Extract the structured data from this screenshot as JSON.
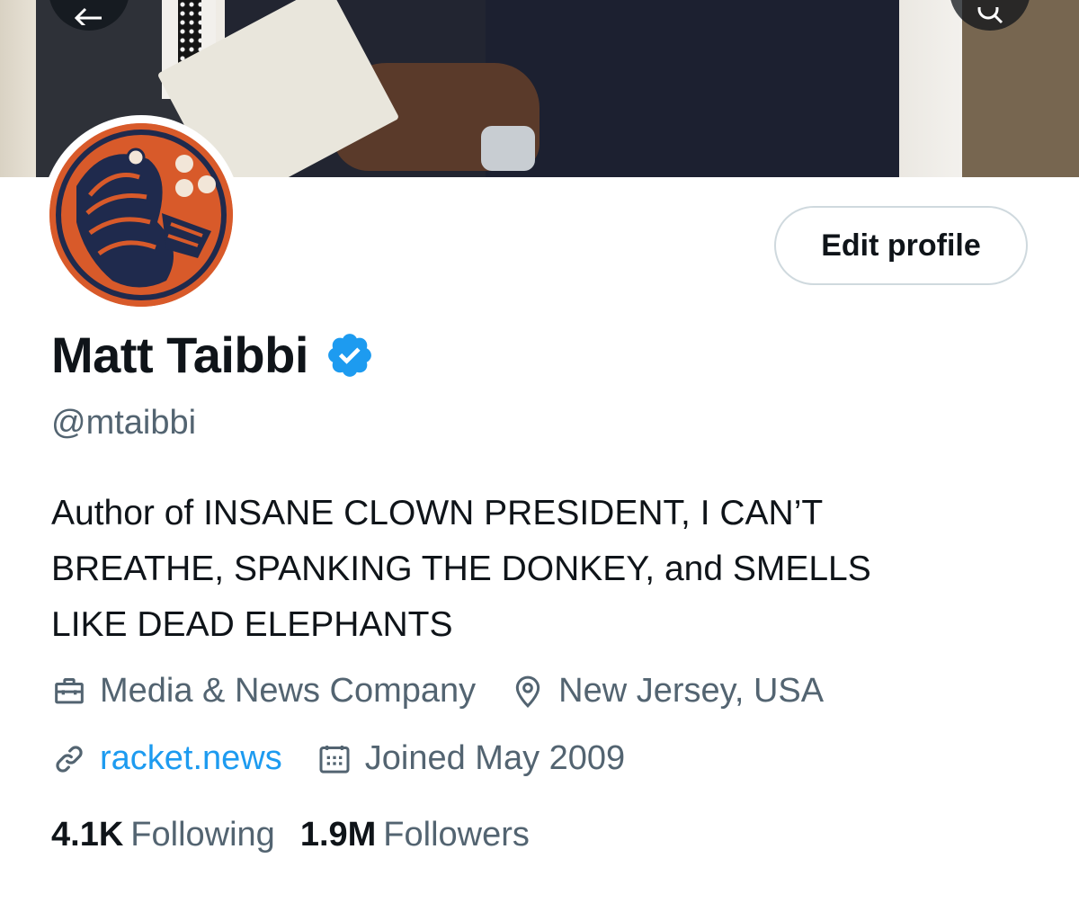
{
  "banner": {
    "kind": "header-photo"
  },
  "nav": {
    "back_icon": "arrow-left-icon",
    "search_icon": "search-icon"
  },
  "avatar": {
    "kind": "fish-emblem-avatar",
    "colors": {
      "orange": "#d85a2a",
      "navy": "#1f2a4d"
    }
  },
  "actions": {
    "edit_profile_label": "Edit profile"
  },
  "profile": {
    "name": "Matt Taibbi",
    "verified_icon": "verified-badge-icon",
    "handle": "@mtaibbi",
    "bio_lines": [
      "Author of INSANE CLOWN PRESIDENT, I CAN’T",
      "BREATHE, SPANKING THE DONKEY, and SMELLS",
      "LIKE DEAD ELEPHANTS"
    ],
    "category": "Media & News Company",
    "location": "New Jersey, USA",
    "website": "racket.news",
    "joined": "Joined May 2009"
  },
  "stats": {
    "following_count": "4.1K",
    "following_label": "Following",
    "followers_count": "1.9M",
    "followers_label": "Followers"
  },
  "colors": {
    "text_primary": "#0f1419",
    "text_secondary": "#536471",
    "link": "#1d9bf0",
    "verified": "#1d9bf0",
    "button_border": "#cfd9de"
  }
}
